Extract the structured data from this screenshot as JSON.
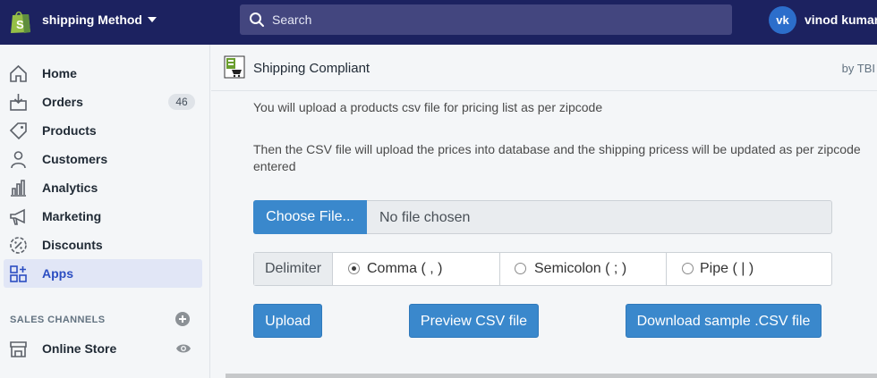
{
  "topbar": {
    "store_name": "shipping Method",
    "search_placeholder": "Search",
    "avatar_initials": "vk",
    "user_name": "vinod kumar",
    "brand_color": "#1c2260",
    "logo_icon": "shopify-bag-icon"
  },
  "sidebar": {
    "items": [
      {
        "label": "Home",
        "icon": "home-icon"
      },
      {
        "label": "Orders",
        "icon": "orders-icon",
        "badge": "46"
      },
      {
        "label": "Products",
        "icon": "tag-icon"
      },
      {
        "label": "Customers",
        "icon": "person-icon"
      },
      {
        "label": "Analytics",
        "icon": "bar-chart-icon"
      },
      {
        "label": "Marketing",
        "icon": "megaphone-icon"
      },
      {
        "label": "Discounts",
        "icon": "discount-icon"
      },
      {
        "label": "Apps",
        "icon": "apps-icon",
        "active": true
      }
    ],
    "sales_channels_label": "SALES CHANNELS",
    "online_store_label": "Online Store"
  },
  "app": {
    "title": "Shipping Compliant",
    "by": "by TBI"
  },
  "content": {
    "para1": "You will upload a products csv file for pricing list as per zipcode",
    "para2": "Then the CSV file will upload the prices into database and the shipping pricess will be updated as per zipcode entered",
    "choose_file_label": "Choose File...",
    "no_file_label": "No file chosen",
    "delimiter_label": "Delimiter",
    "delimiter_options": [
      {
        "label": "Comma ( , )",
        "checked": true
      },
      {
        "label": "Semicolon ( ; )",
        "checked": false
      },
      {
        "label": "Pipe ( | )",
        "checked": false
      }
    ],
    "upload_label": "Upload",
    "preview_label": "Preview CSV file",
    "download_label": "Download sample .CSV file",
    "accent_color": "#3a88cc"
  }
}
